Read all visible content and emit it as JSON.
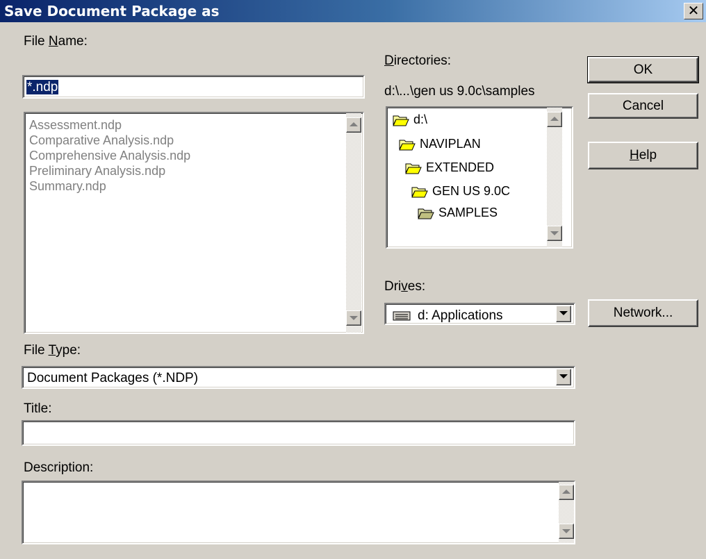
{
  "window": {
    "title": "Save Document Package as",
    "close_glyph": "✕"
  },
  "file_name": {
    "label_pre": "File ",
    "label_key": "N",
    "label_post": "ame:",
    "value": "*.ndp",
    "files": [
      "Assessment.ndp",
      "Comparative Analysis.ndp",
      "Comprehensive Analysis.ndp",
      "Preliminary Analysis.ndp",
      "Summary.ndp"
    ]
  },
  "directories": {
    "label_pre": "",
    "label_key": "D",
    "label_post": "irectories:",
    "current_path": "d:\\...\\gen us 9.0c\\samples",
    "tree": [
      "d:\\",
      "NAVIPLAN",
      "EXTENDED",
      "GEN US 9.0C",
      "SAMPLES"
    ]
  },
  "drives": {
    "label_pre": "Dri",
    "label_key": "v",
    "label_post": "es:",
    "value": "d: Applications",
    "icon": "drive-icon"
  },
  "buttons": {
    "ok": "OK",
    "cancel": "Cancel",
    "help_key": "H",
    "help_post": "elp",
    "network": "Network..."
  },
  "file_type": {
    "label_pre": "File ",
    "label_key": "T",
    "label_post": "ype:",
    "value": "Document Packages (*.NDP)"
  },
  "title_field": {
    "label": "Title:",
    "value": ""
  },
  "description_field": {
    "label": "Description:",
    "value": ""
  },
  "colors": {
    "title_bar": "#0a246a",
    "face": "#d4d0c8",
    "selection": "#0a246a"
  }
}
